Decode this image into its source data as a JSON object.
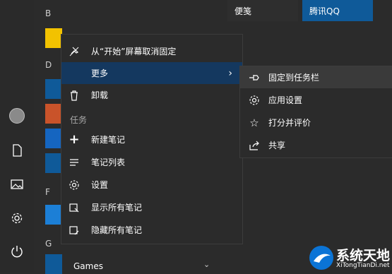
{
  "list": {
    "letters": {
      "b": "B",
      "d": "D",
      "f": "F",
      "g": "G"
    },
    "games_label": "Games"
  },
  "tiles": {
    "tile1": "便笺",
    "tile2": "腾讯QQ"
  },
  "context_menu": {
    "unpin": "从“开始”屏幕取消固定",
    "more": "更多",
    "uninstall": "卸载",
    "section_tasks": "任务",
    "new_note": "新建笔记",
    "note_list": "笔记列表",
    "settings": "设置",
    "show_all": "显示所有笔记",
    "hide_all": "隐藏所有笔记"
  },
  "submenu": {
    "pin_taskbar": "固定到任务栏",
    "app_settings": "应用设置",
    "rate_review": "打分并评价",
    "share": "共享"
  },
  "watermark": {
    "title": "系统天地",
    "url": "XiTongTianDi.net"
  },
  "colors": {
    "highlight": "#14385f",
    "tile_blue": "#0f5a99",
    "accent": "#0b74d6"
  }
}
